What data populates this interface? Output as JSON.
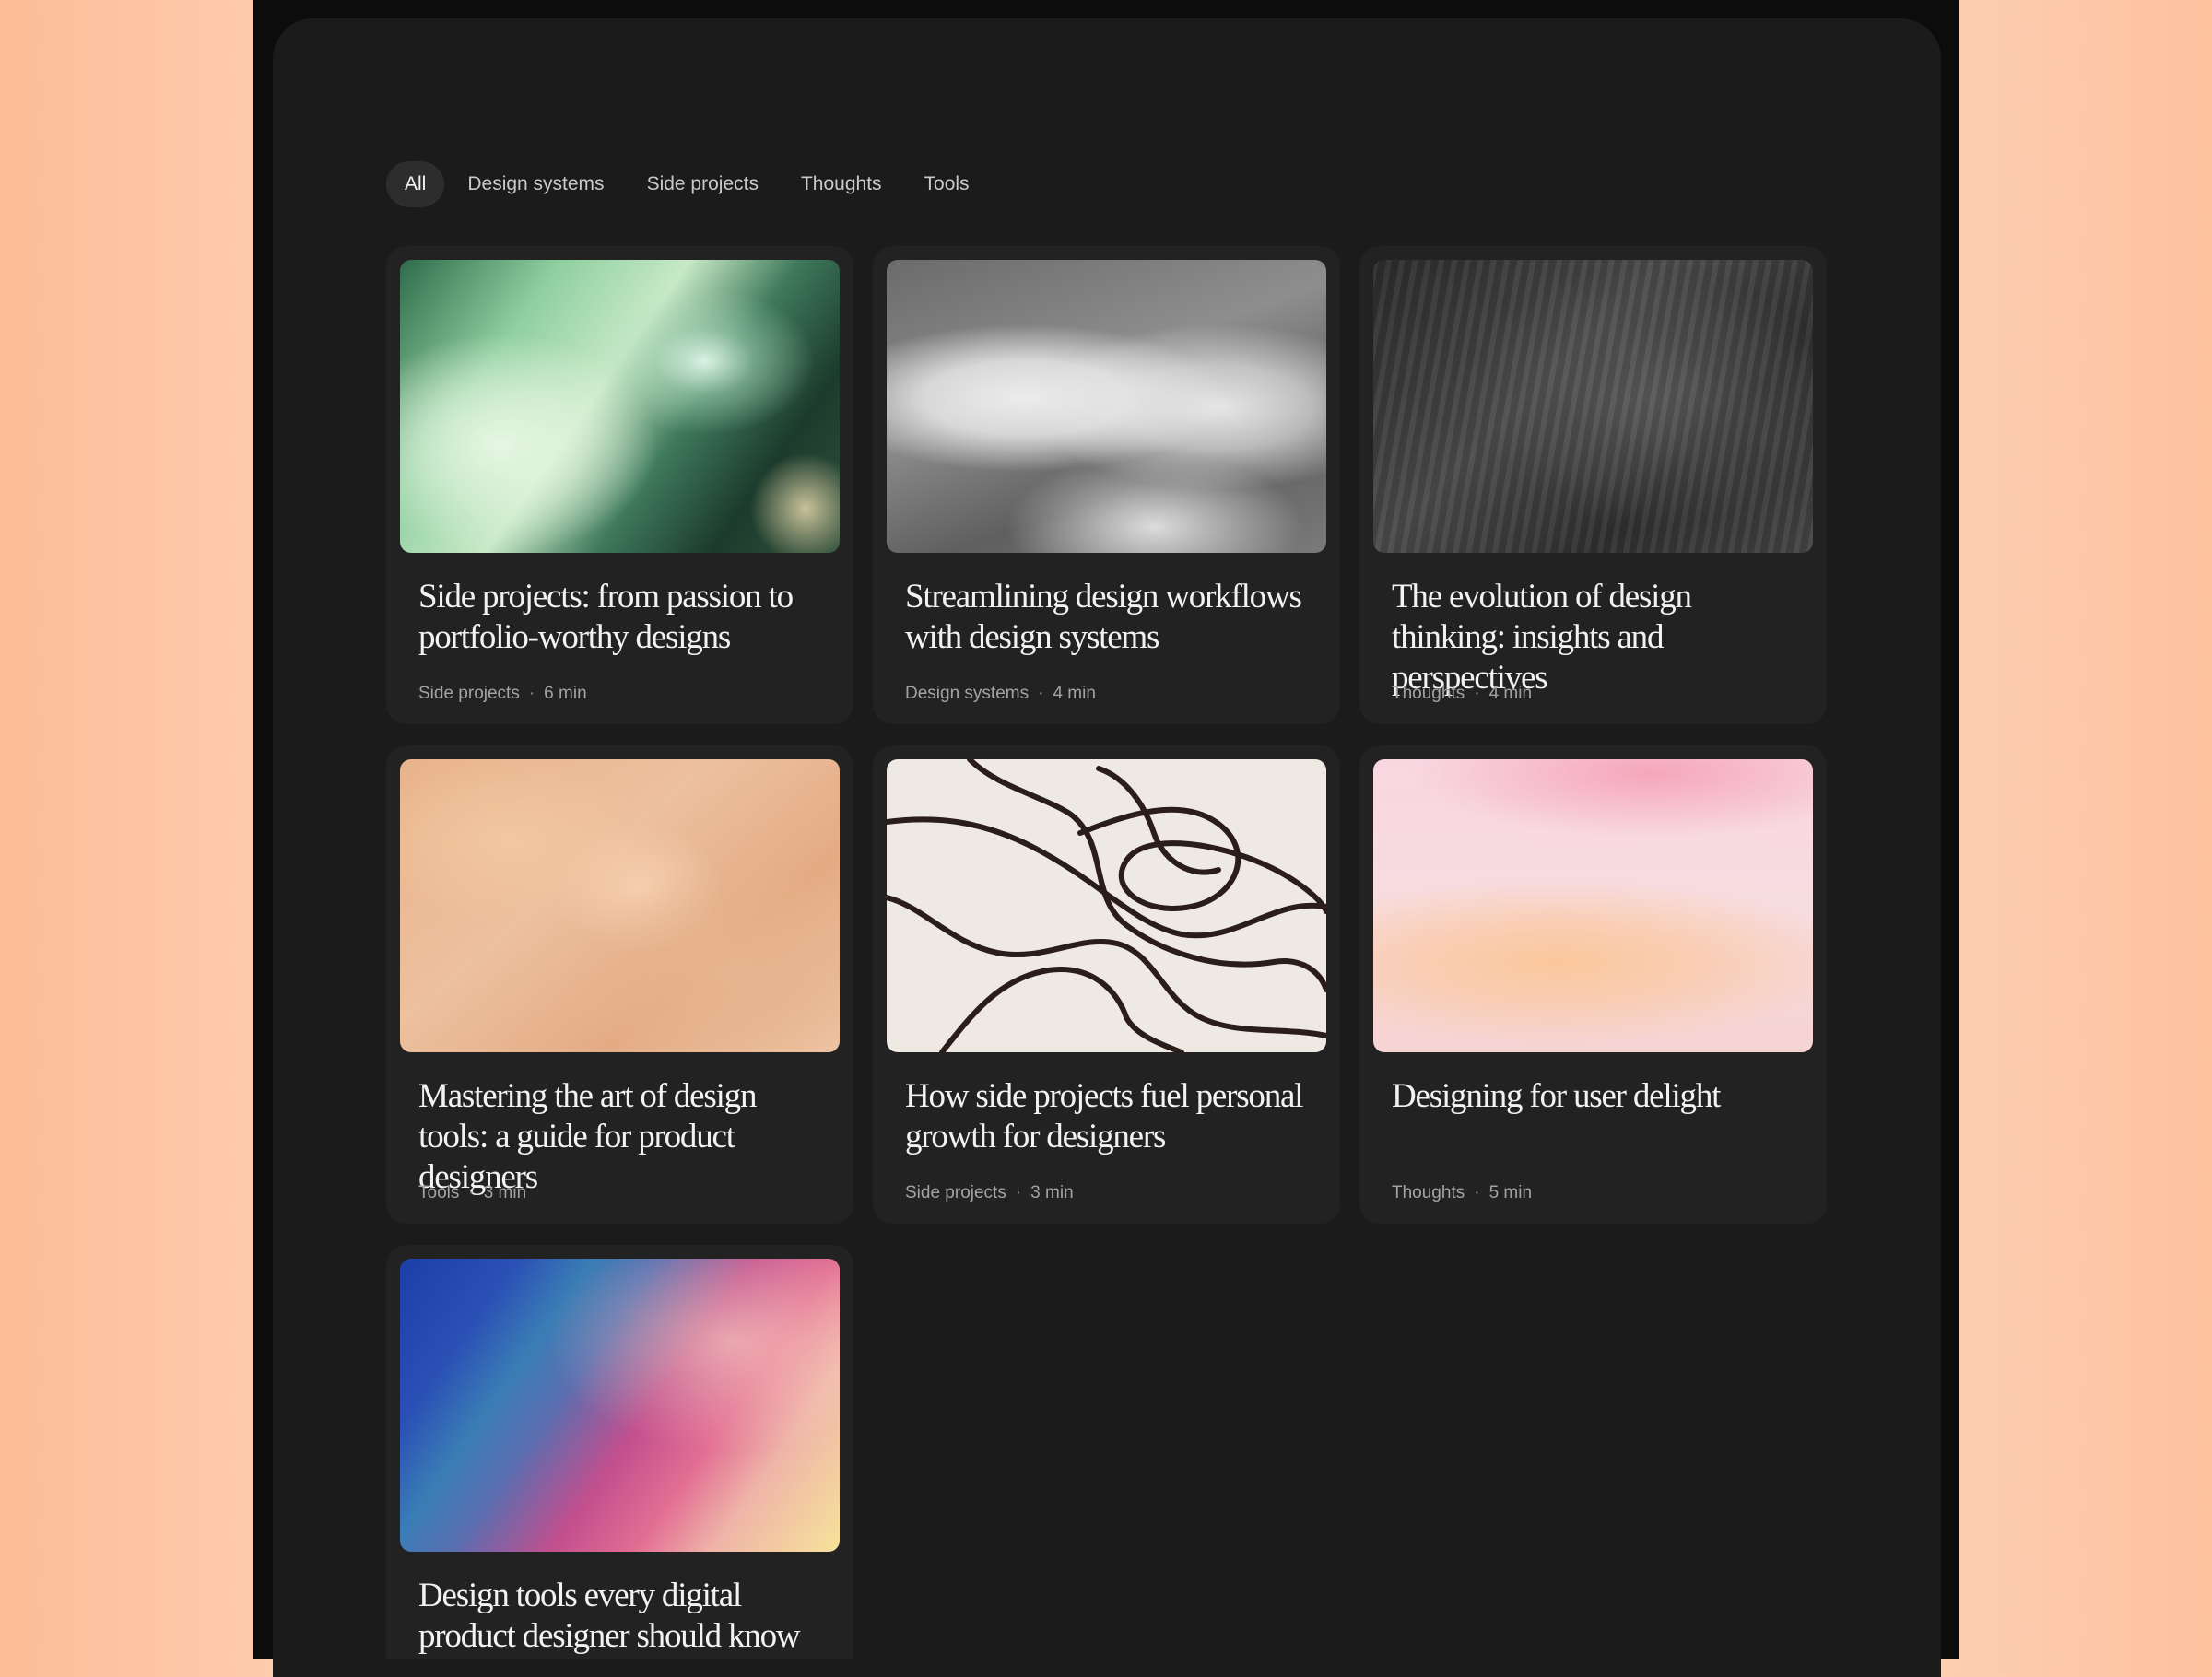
{
  "filters": {
    "items": [
      "All",
      "Design systems",
      "Side projects",
      "Thoughts",
      "Tools"
    ],
    "active": "All"
  },
  "posts": [
    {
      "title": "Side projects: from passion to portfolio-worthy designs",
      "category": "Side projects",
      "read_time": "6 min",
      "image": "green-blur-photo"
    },
    {
      "title": "Streamlining design workflows with design systems",
      "category": "Design systems",
      "read_time": "4 min",
      "image": "gray-shadow-photo"
    },
    {
      "title": "The evolution of design thinking: insights and perspectives",
      "category": "Thoughts",
      "read_time": "4 min",
      "image": "dark-brushstroke-photo"
    },
    {
      "title": "Mastering the art of design tools: a guide for product designers",
      "category": "Tools",
      "read_time": "3 min",
      "image": "peach-texture-photo"
    },
    {
      "title": "How side projects fuel personal growth for designers",
      "category": "Side projects",
      "read_time": "3 min",
      "image": "scribble-lines-photo"
    },
    {
      "title": "Designing for user delight",
      "category": "Thoughts",
      "read_time": "5 min",
      "image": "pink-watercolor-photo"
    },
    {
      "title": "Design tools every digital product designer should know",
      "category": "",
      "read_time": "",
      "image": "rainbow-gradient-photo"
    }
  ],
  "separator": "·"
}
